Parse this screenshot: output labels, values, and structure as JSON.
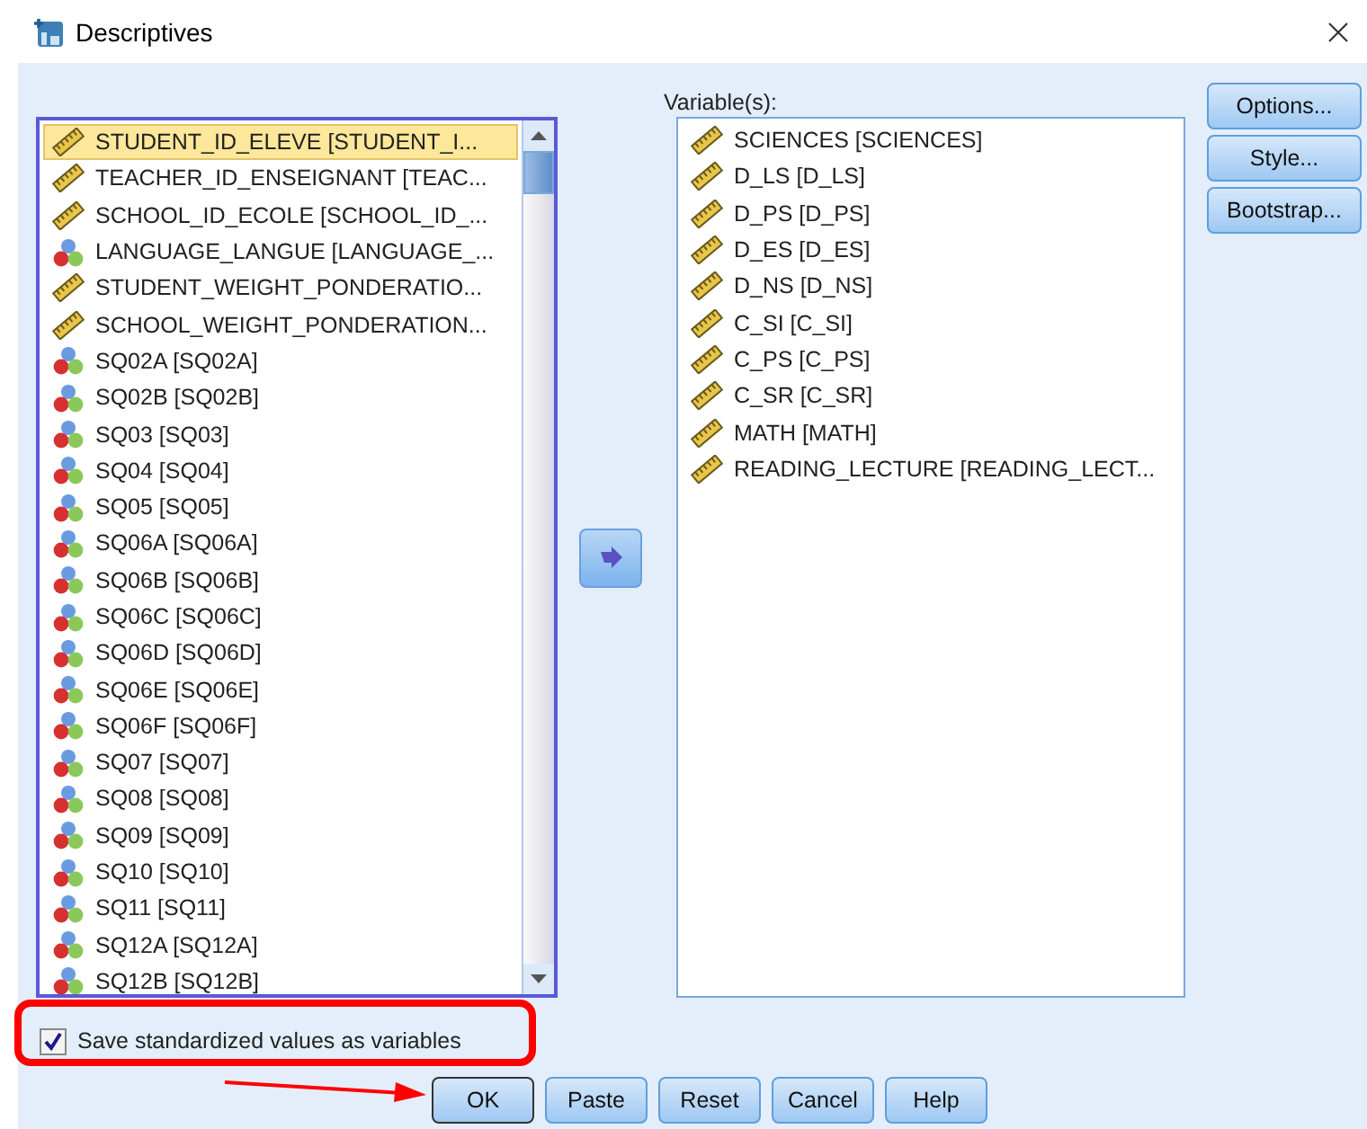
{
  "window": {
    "title": "Descriptives"
  },
  "source_list": {
    "items": [
      {
        "name": "STUDENT_ID_ELEVE [STUDENT_I...",
        "kind": "scale",
        "selected": true
      },
      {
        "name": "TEACHER_ID_ENSEIGNANT [TEAC...",
        "kind": "scale",
        "selected": false
      },
      {
        "name": "SCHOOL_ID_ECOLE [SCHOOL_ID_...",
        "kind": "scale",
        "selected": false
      },
      {
        "name": "LANGUAGE_LANGUE [LANGUAGE_...",
        "kind": "nominal",
        "selected": false
      },
      {
        "name": "STUDENT_WEIGHT_PONDERATIO...",
        "kind": "scale",
        "selected": false
      },
      {
        "name": "SCHOOL_WEIGHT_PONDERATION...",
        "kind": "scale",
        "selected": false
      },
      {
        "name": "SQ02A [SQ02A]",
        "kind": "nominal",
        "selected": false
      },
      {
        "name": "SQ02B [SQ02B]",
        "kind": "nominal",
        "selected": false
      },
      {
        "name": "SQ03 [SQ03]",
        "kind": "nominal",
        "selected": false
      },
      {
        "name": "SQ04 [SQ04]",
        "kind": "nominal",
        "selected": false
      },
      {
        "name": "SQ05 [SQ05]",
        "kind": "nominal",
        "selected": false
      },
      {
        "name": "SQ06A [SQ06A]",
        "kind": "nominal",
        "selected": false
      },
      {
        "name": "SQ06B [SQ06B]",
        "kind": "nominal",
        "selected": false
      },
      {
        "name": "SQ06C [SQ06C]",
        "kind": "nominal",
        "selected": false
      },
      {
        "name": "SQ06D [SQ06D]",
        "kind": "nominal",
        "selected": false
      },
      {
        "name": "SQ06E [SQ06E]",
        "kind": "nominal",
        "selected": false
      },
      {
        "name": "SQ06F [SQ06F]",
        "kind": "nominal",
        "selected": false
      },
      {
        "name": "SQ07 [SQ07]",
        "kind": "nominal",
        "selected": false
      },
      {
        "name": "SQ08 [SQ08]",
        "kind": "nominal",
        "selected": false
      },
      {
        "name": "SQ09 [SQ09]",
        "kind": "nominal",
        "selected": false
      },
      {
        "name": "SQ10 [SQ10]",
        "kind": "nominal",
        "selected": false
      },
      {
        "name": "SQ11 [SQ11]",
        "kind": "nominal",
        "selected": false
      },
      {
        "name": "SQ12A [SQ12A]",
        "kind": "nominal",
        "selected": false
      },
      {
        "name": "SQ12B [SQ12B]",
        "kind": "nominal",
        "selected": false
      }
    ]
  },
  "target_list": {
    "label": "Variable(s):",
    "items": [
      {
        "name": "SCIENCES [SCIENCES]",
        "kind": "scale",
        "selected": false
      },
      {
        "name": "D_LS [D_LS]",
        "kind": "scale",
        "selected": false
      },
      {
        "name": "D_PS [D_PS]",
        "kind": "scale",
        "selected": false
      },
      {
        "name": "D_ES [D_ES]",
        "kind": "scale",
        "selected": false
      },
      {
        "name": "D_NS [D_NS]",
        "kind": "scale",
        "selected": false
      },
      {
        "name": "C_SI [C_SI]",
        "kind": "scale",
        "selected": false
      },
      {
        "name": "C_PS [C_PS]",
        "kind": "scale",
        "selected": false
      },
      {
        "name": "C_SR [C_SR]",
        "kind": "scale",
        "selected": false
      },
      {
        "name": "MATH [MATH]",
        "kind": "scale",
        "selected": false
      },
      {
        "name": "READING_LECTURE [READING_LECT...",
        "kind": "scale",
        "selected": false
      }
    ]
  },
  "side_buttons": [
    "Options...",
    "Style...",
    "Bootstrap..."
  ],
  "save_checkbox": {
    "label": "Save standardized values as variables",
    "checked": true
  },
  "buttons": [
    {
      "label": "OK",
      "default": true
    },
    {
      "label": "Paste",
      "default": false
    },
    {
      "label": "Reset",
      "default": false
    },
    {
      "label": "Cancel",
      "default": false
    },
    {
      "label": "Help",
      "default": false
    }
  ]
}
